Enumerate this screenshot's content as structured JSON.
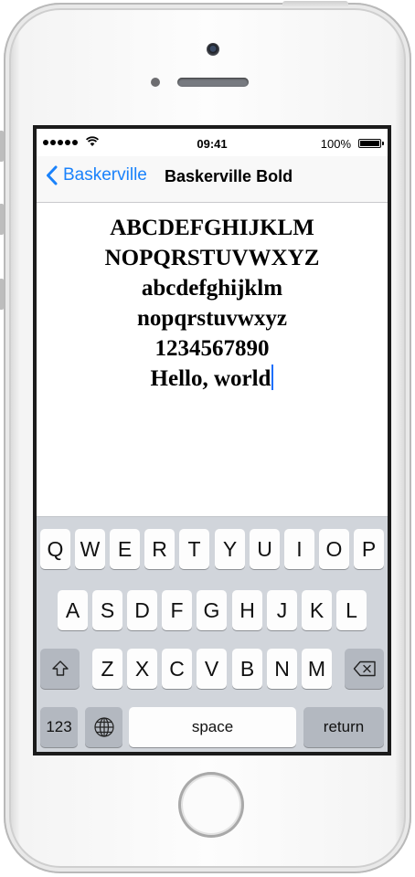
{
  "status_bar": {
    "time": "09:41",
    "battery": "100%"
  },
  "navbar": {
    "back_label": "Baskerville",
    "title": "Baskerville Bold"
  },
  "document": {
    "lines": [
      "ABCDEFGHIJKLM",
      "NOPQRSTUVWXYZ",
      "abcdefghijklm",
      "nopqrstuvwxyz",
      "1234567890",
      "Hello, world"
    ]
  },
  "keyboard": {
    "row1": [
      "Q",
      "W",
      "E",
      "R",
      "T",
      "Y",
      "U",
      "I",
      "O",
      "P"
    ],
    "row2": [
      "A",
      "S",
      "D",
      "F",
      "G",
      "H",
      "J",
      "K",
      "L"
    ],
    "row3": [
      "Z",
      "X",
      "C",
      "V",
      "B",
      "N",
      "M"
    ],
    "numbers_label": "123",
    "space_label": "space",
    "return_label": "return"
  },
  "colors": {
    "accent": "#1a82fb",
    "cursor": "#1a6efb",
    "keyboard_bg": "#d1d5db",
    "key_bg": "#fdfdfd",
    "dark_key_bg": "#b3b8c0"
  }
}
